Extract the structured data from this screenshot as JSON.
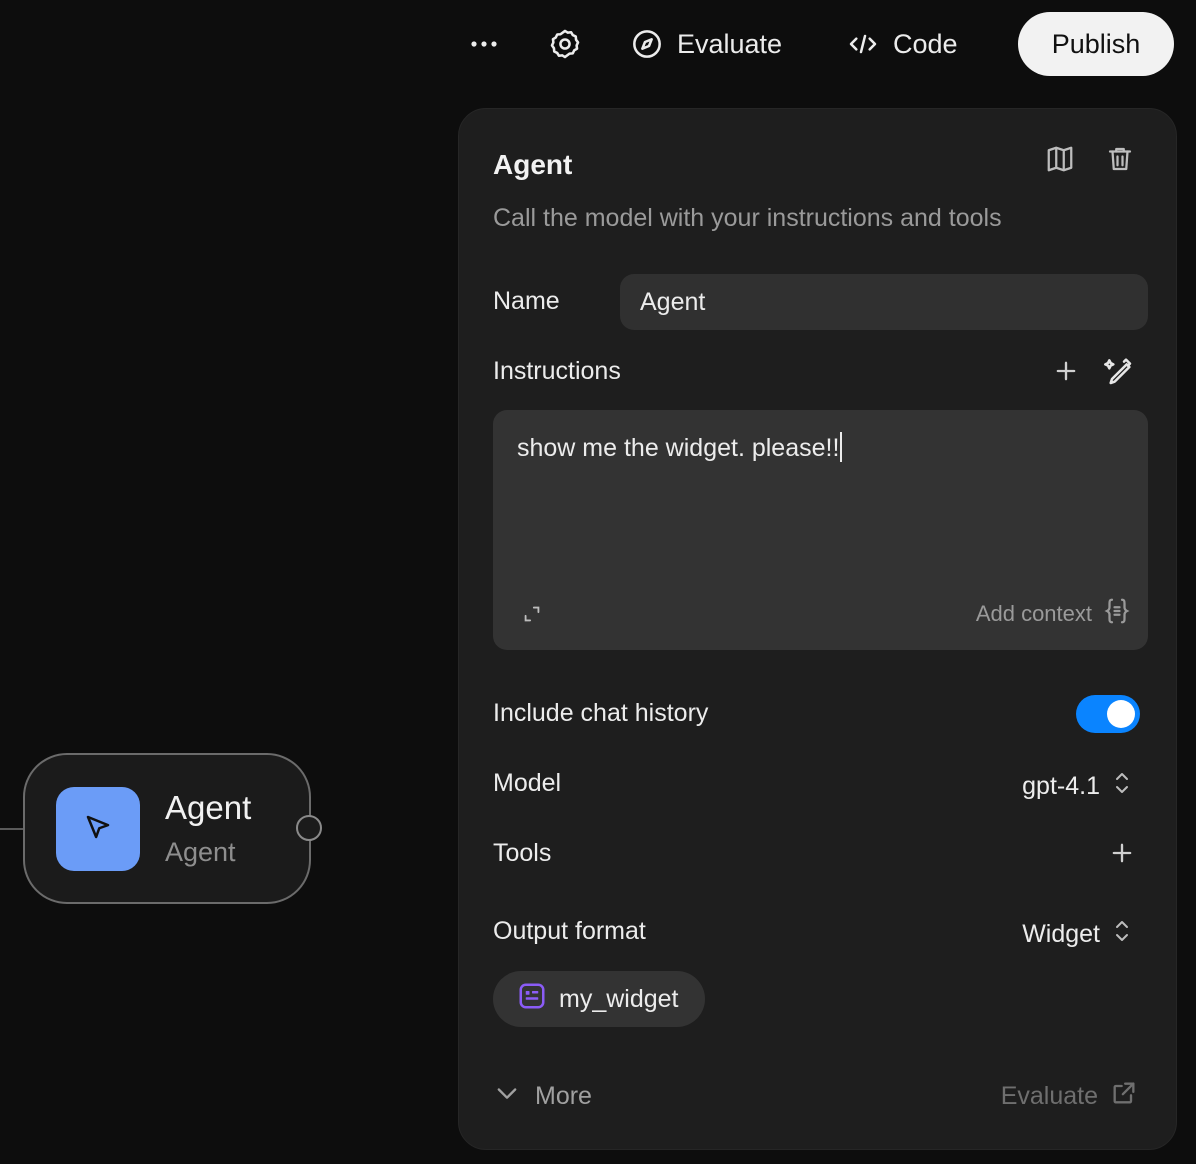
{
  "toolbar": {
    "more_icon": "more-horizontal-icon",
    "settings_icon": "gear-icon",
    "evaluate_label": "Evaluate",
    "evaluate_icon": "compass-icon",
    "code_label": "Code",
    "code_icon": "code-icon",
    "publish_label": "Publish"
  },
  "node": {
    "title": "Agent",
    "subtitle": "Agent",
    "icon": "cursor-arrow-icon",
    "icon_bg": "#6b9cf7"
  },
  "panel": {
    "title": "Agent",
    "description": "Call the model with your instructions and tools",
    "actions": [
      "book-icon",
      "trash-icon"
    ],
    "name": {
      "label": "Name",
      "value": "Agent"
    },
    "instructions": {
      "label": "Instructions",
      "value": "show me the widget. please!!",
      "add_context_label": "Add context",
      "add_icon": "plus-icon",
      "magic_icon": "magic-pen-icon",
      "expand_icon": "expand-icon",
      "context_icon": "braces-icon"
    },
    "chat_history": {
      "label": "Include chat history",
      "enabled": true,
      "accent": "#0a84ff"
    },
    "model": {
      "label": "Model",
      "value": "gpt-4.1"
    },
    "tools": {
      "label": "Tools"
    },
    "output_format": {
      "label": "Output format",
      "value": "Widget",
      "widget_name": "my_widget",
      "widget_icon_color": "#8b5cf6"
    },
    "more_label": "More",
    "evaluate_label": "Evaluate"
  }
}
